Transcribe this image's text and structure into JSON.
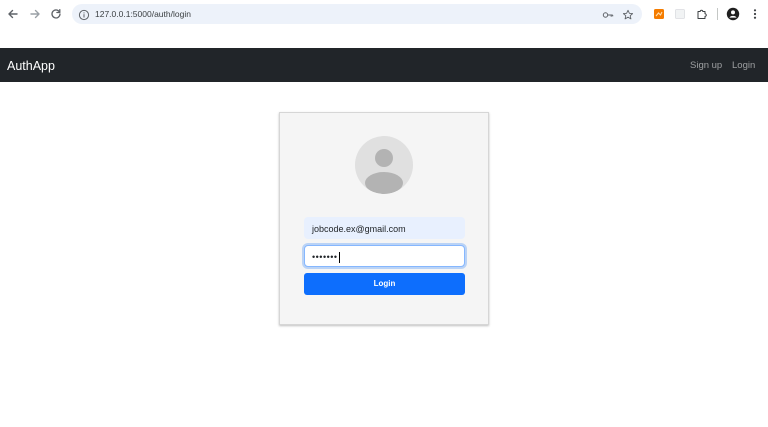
{
  "browser": {
    "url": "127.0.0.1:5000/auth/login"
  },
  "navbar": {
    "brand": "AuthApp",
    "links": {
      "signup": "Sign up",
      "login": "Login"
    }
  },
  "form": {
    "email_value": "jobcode.ex@gmail.com",
    "password_masked": "•••••••",
    "submit_label": "Login"
  },
  "colors": {
    "navbar_bg": "#212529",
    "primary": "#0d6efd",
    "card_bg": "#f5f5f5",
    "autofill_bg": "#e8f0fe"
  }
}
